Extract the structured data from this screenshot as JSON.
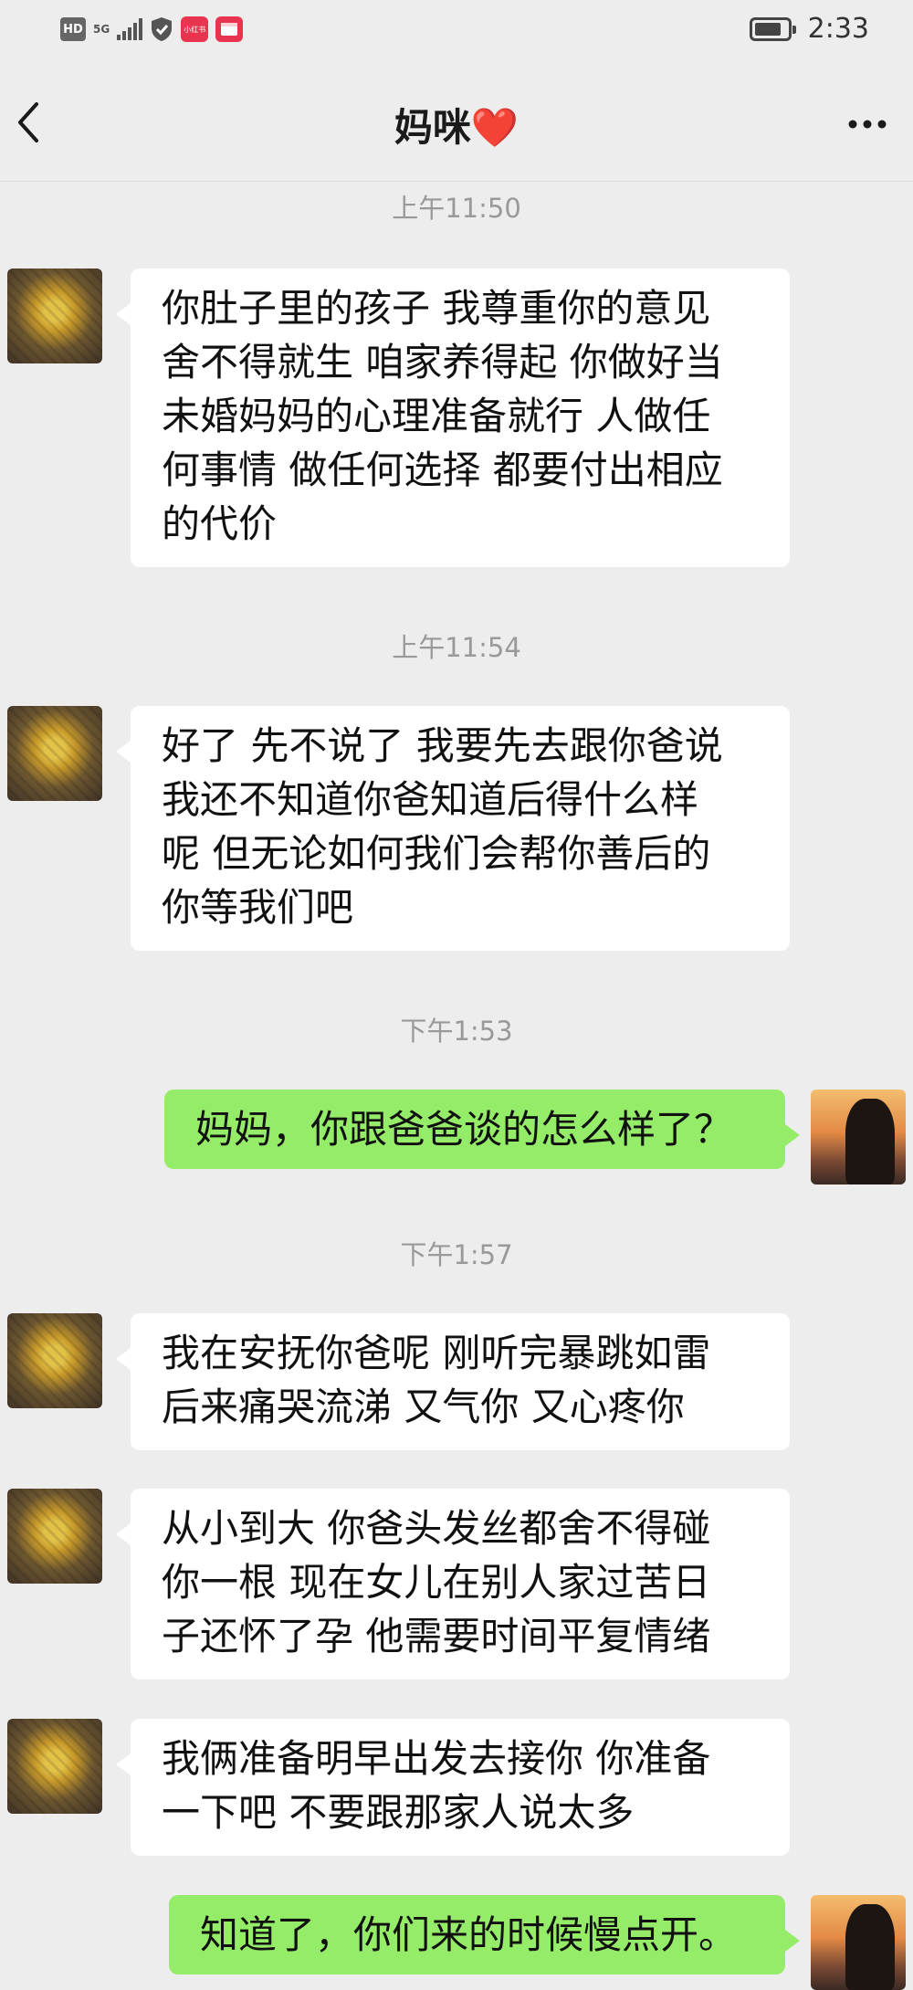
{
  "status_bar": {
    "hd": "HD",
    "network": "5G",
    "app_badge": "小红书",
    "time": "2:33"
  },
  "nav": {
    "title": "妈咪❤️"
  },
  "messages": [
    {
      "time": "上午11:50"
    },
    {
      "from": "mom",
      "lines": [
        "你肚子里的孩子 我尊重你的意见",
        "舍不得就生 咱家养得起 你做好当",
        "未婚妈妈的心理准备就行  人做任",
        "何事情 做任何选择 都要付出相应",
        "的代价"
      ]
    },
    {
      "time": "上午11:54"
    },
    {
      "from": "mom",
      "lines": [
        "好了 先不说了 我要先去跟你爸说",
        "我还不知道你爸知道后得什么样",
        "呢 但无论如何我们会帮你善后的",
        "你等我们吧"
      ]
    },
    {
      "time": "下午1:53"
    },
    {
      "from": "me",
      "lines": [
        "妈妈，你跟爸爸谈的怎么样了？"
      ]
    },
    {
      "time": "下午1:57"
    },
    {
      "from": "mom",
      "lines": [
        "我在安抚你爸呢 刚听完暴跳如雷",
        "后来痛哭流涕  又气你 又心疼你"
      ]
    },
    {
      "from": "mom",
      "lines": [
        "从小到大 你爸头发丝都舍不得碰",
        "你一根 现在女儿在别人家过苦日",
        "子还怀了孕 他需要时间平复情绪"
      ]
    },
    {
      "from": "mom",
      "lines": [
        "我俩准备明早出发去接你 你准备",
        "一下吧 不要跟那家人说太多"
      ]
    },
    {
      "from": "me",
      "lines": [
        "知道了，你们来的时候慢点开。"
      ]
    }
  ],
  "colors": {
    "background": "#ededed",
    "incoming_bubble": "#ffffff",
    "outgoing_bubble": "#95ec69",
    "timestamp": "#999999"
  },
  "icons": [
    "back-arrow-icon",
    "more-dots-icon",
    "signal-icon",
    "shield-icon",
    "battery-icon"
  ]
}
